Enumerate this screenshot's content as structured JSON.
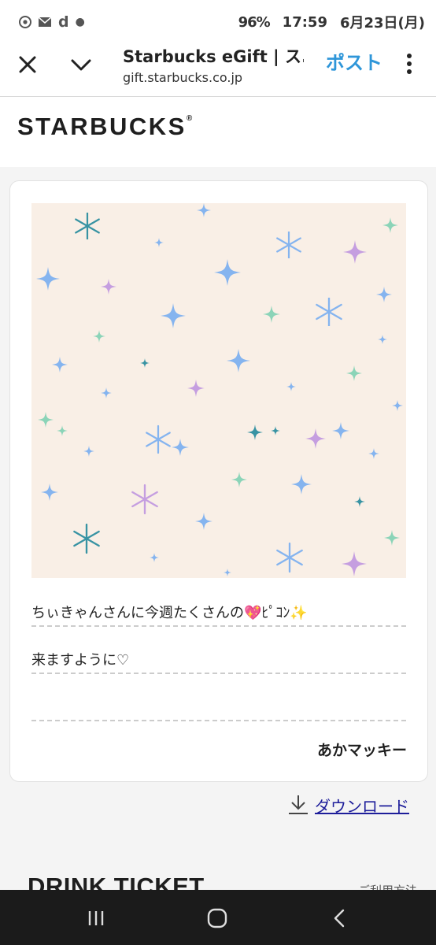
{
  "status": {
    "battery": "96%",
    "time": "17:59",
    "date": "6月23日(月)",
    "icons": [
      "chrome-icon",
      "mail-icon",
      "d-icon",
      "dot-icon"
    ]
  },
  "appbar": {
    "title": "Starbucks eGift | ス...",
    "url": "gift.starbucks.co.jp",
    "post_label": "ポスト"
  },
  "brand": {
    "logo_text": "STARBUCKS",
    "registered_mark": "®"
  },
  "card": {
    "message_lines": [
      "ちぃきゃんさんに今週たくさんの💖ﾋﾟｺﾝ✨",
      "来ますように♡",
      ""
    ],
    "sender": "あかマッキー",
    "art_background": "#f9efe6",
    "sparkle_colors": [
      "#7fb1f0",
      "#c39ae0",
      "#86d3b6",
      "#2e8fa0"
    ]
  },
  "download": {
    "label": "ダウンロード",
    "icon": "download-icon"
  },
  "section": {
    "title": "DRINK TICKET",
    "link": "ご利用方法"
  },
  "navbar": {
    "buttons": [
      "recent-apps",
      "home",
      "back"
    ]
  }
}
